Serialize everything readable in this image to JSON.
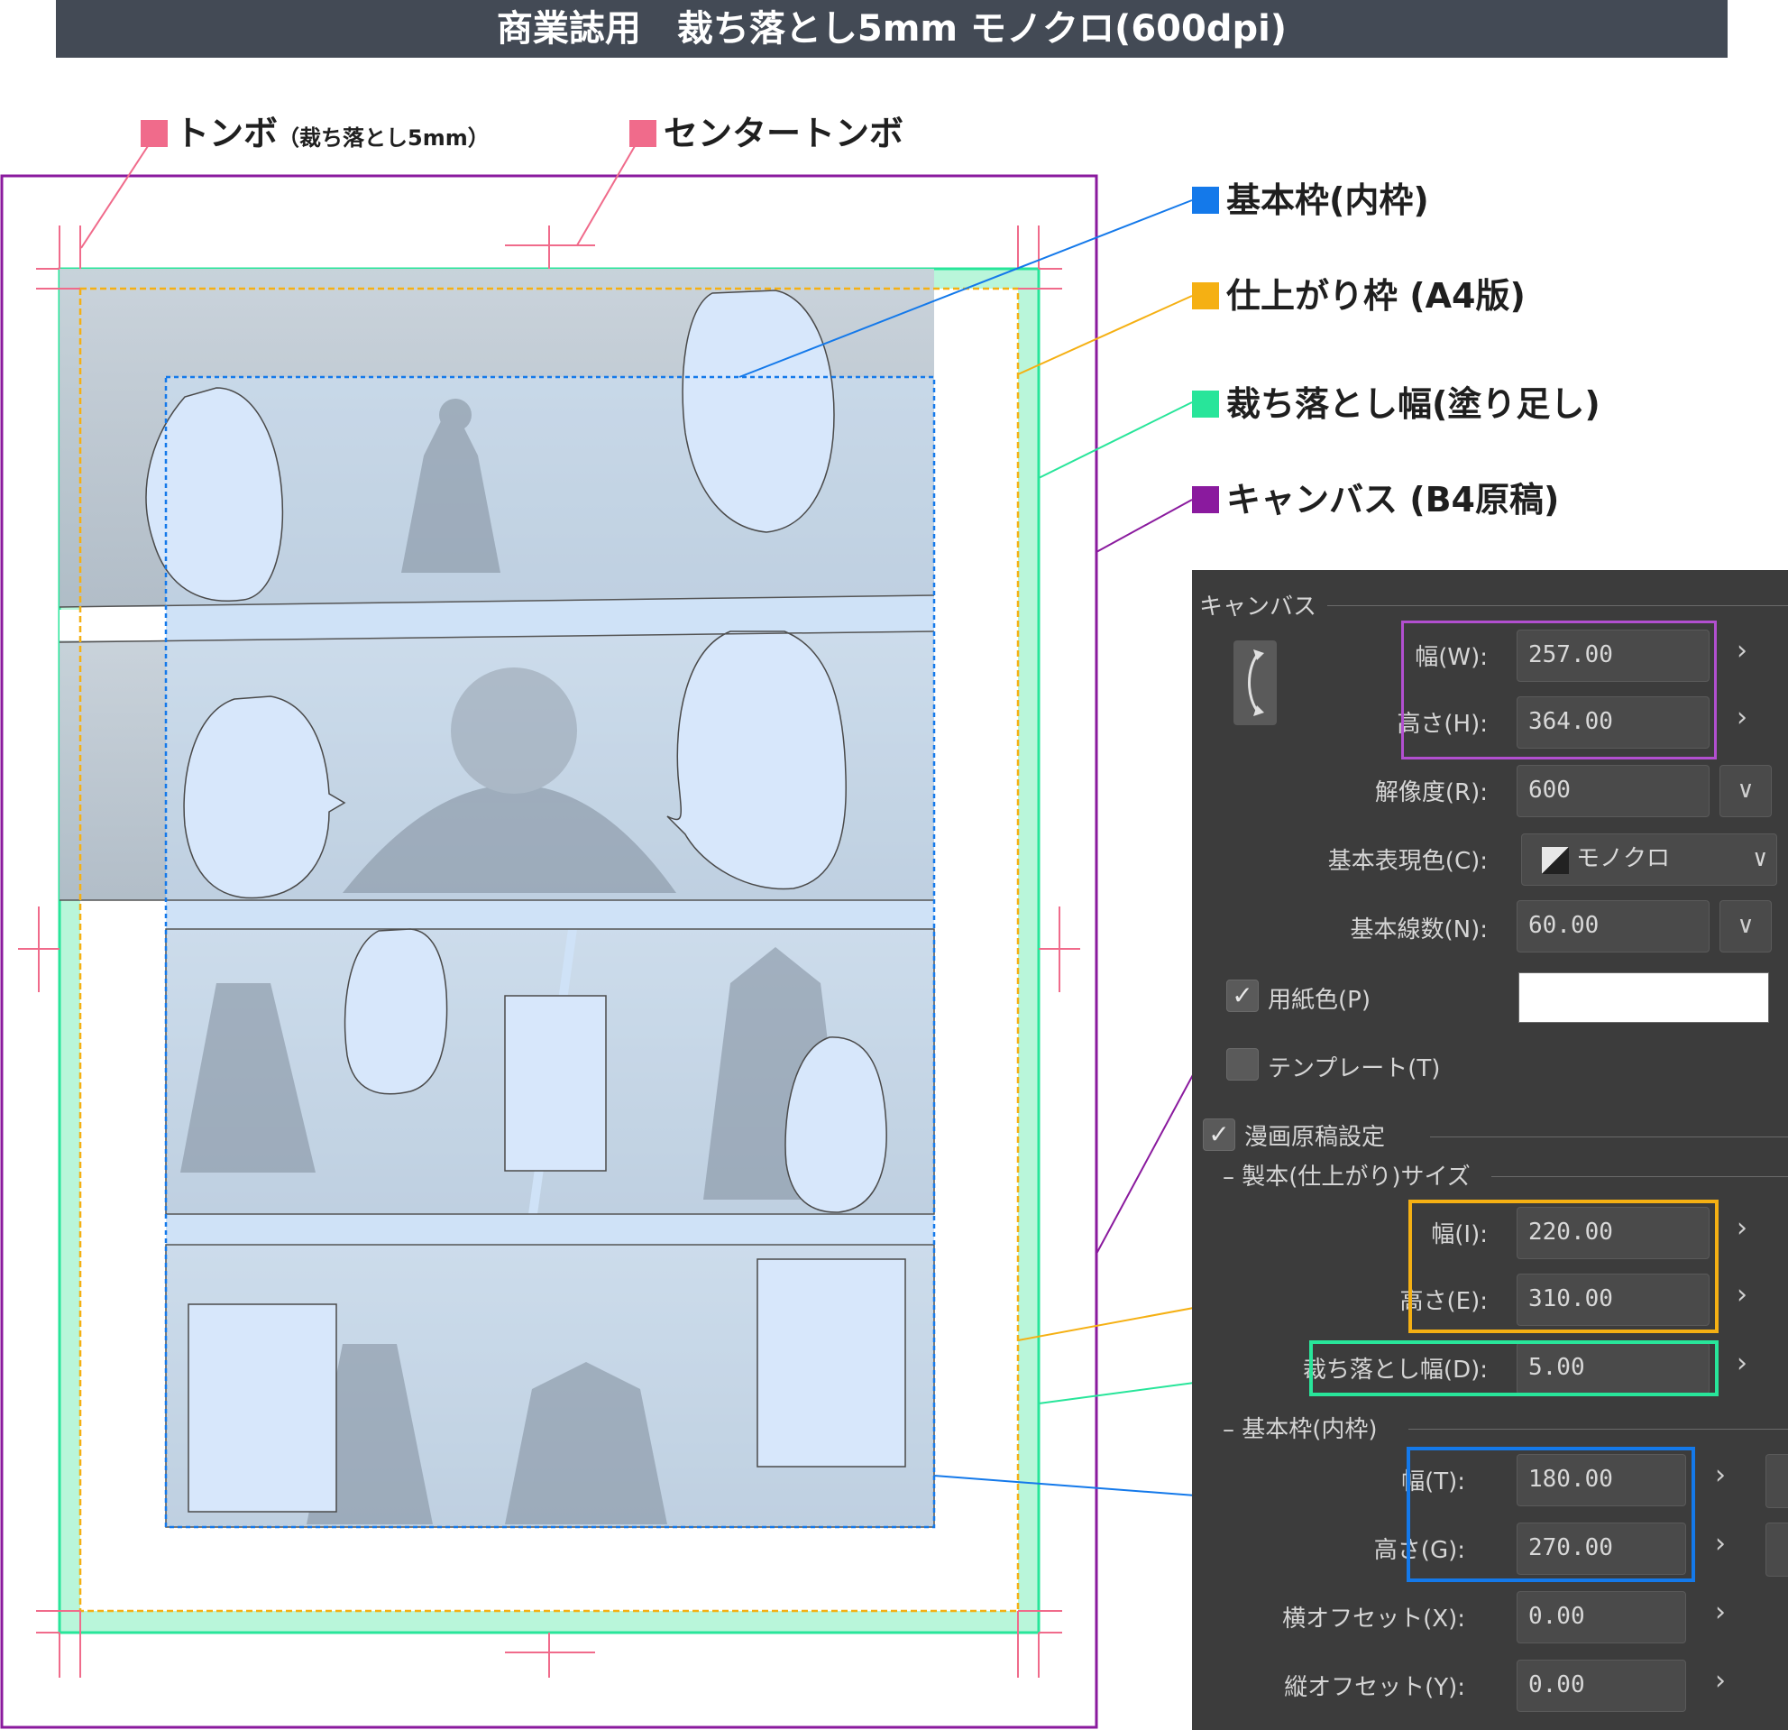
{
  "title": "商業誌用　裁ち落とし5mm モノクロ(600dpi)",
  "colors": {
    "tombo": "#f06b8b",
    "base_frame": "#1479ea",
    "finish_frame": "#f5b013",
    "bleed": "#28e59a",
    "canvas": "#8a1a9e"
  },
  "legend": {
    "tombo": {
      "label": "トンボ",
      "note": "（裁ち落とし5mm）"
    },
    "center_tombo": {
      "label": "センタートンボ"
    },
    "base_frame": {
      "label": "基本枠(内枠)"
    },
    "finish_frame": {
      "label": "仕上がり枠 (A4版)"
    },
    "bleed": {
      "label": "裁ち落とし幅(塗り足し)"
    },
    "canvas": {
      "label": "キャンバス (B4原稿)"
    }
  },
  "dialog": {
    "canvas_section": "キャンバス",
    "width_label": "幅(W):",
    "width_value": "257.00",
    "height_label": "高さ(H):",
    "height_value": "364.00",
    "resolution_label": "解像度(R):",
    "resolution_value": "600",
    "color_label": "基本表現色(C):",
    "color_value": "モノクロ",
    "lines_label": "基本線数(N):",
    "lines_value": "60.00",
    "paper_label": "用紙色(P)",
    "template_label": "テンプレート(T)",
    "manga_label": "漫画原稿設定",
    "bind_section": "製本(仕上がり)サイズ",
    "bind_width_label": "幅(I):",
    "bind_width_value": "220.00",
    "bind_height_label": "高さ(E):",
    "bind_height_value": "310.00",
    "bleed_label": "裁ち落とし幅(D):",
    "bleed_value": "5.00",
    "frame_section": "基本枠(内枠)",
    "frame_width_label": "幅(T):",
    "frame_width_value": "180.00",
    "frame_height_label": "高さ(G):",
    "frame_height_value": "270.00",
    "xoffset_label": "横オフセット(X):",
    "xoffset_value": "0.00",
    "yoffset_label": "縦オフセット(Y):",
    "yoffset_value": "0.00"
  }
}
